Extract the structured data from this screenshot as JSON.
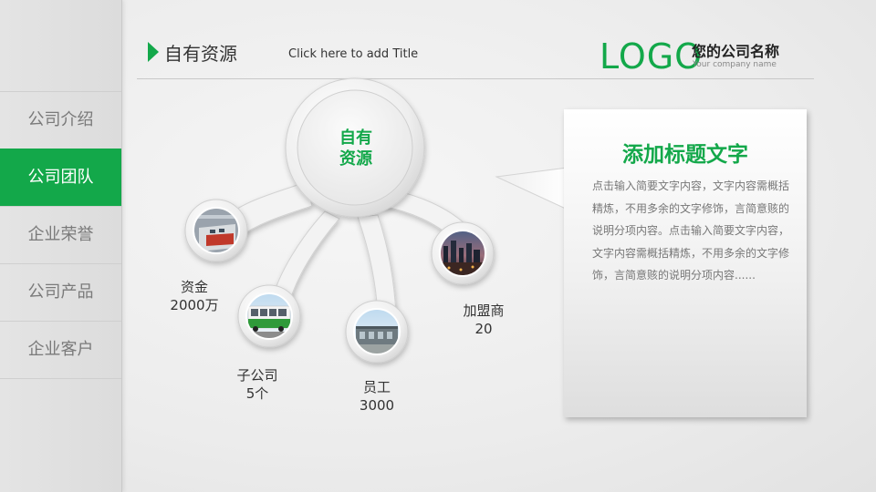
{
  "sidebar": {
    "items": [
      {
        "label": "公司介绍",
        "active": false
      },
      {
        "label": "公司团队",
        "active": true
      },
      {
        "label": "企业荣誉",
        "active": false
      },
      {
        "label": "公司产品",
        "active": false
      },
      {
        "label": "企业客户",
        "active": false
      }
    ]
  },
  "header": {
    "title": "自有资源",
    "subtitle": "Click here to add Title",
    "logo": "LOGO",
    "company_name": "您的公司名称",
    "company_name_en": "Your company name"
  },
  "diagram": {
    "center": "自有\n资源",
    "nodes": [
      {
        "name": "资金",
        "value": "2000万",
        "photo": "subway-train-photo"
      },
      {
        "name": "子公司",
        "value": "5个",
        "photo": "bus-photo"
      },
      {
        "name": "员工",
        "value": "3000",
        "photo": "building-photo"
      },
      {
        "name": "加盟商",
        "value": "20",
        "photo": "city-night-photo"
      }
    ]
  },
  "callout": {
    "title": "添加标题文字",
    "body": "点击输入简要文字内容，文字内容需概括精炼，不用多余的文字修饰，言简意赅的说明分项内容。点击输入简要文字内容，文字内容需概括精炼，不用多余的文字修饰，言简意赅的说明分项内容......"
  },
  "colors": {
    "accent": "#13a84a",
    "sidebar_bg": "#dcdcdc",
    "text_dark": "#333333",
    "text_muted": "#7a7a7a"
  }
}
